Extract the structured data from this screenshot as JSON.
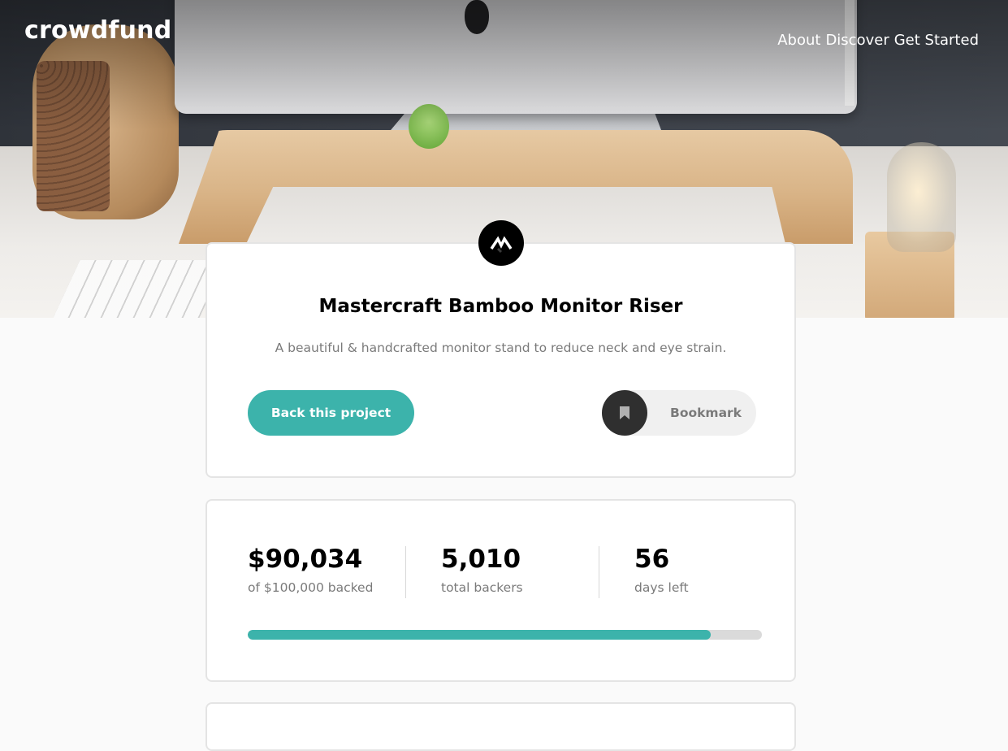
{
  "header": {
    "logo": "crowdfund",
    "nav": [
      "About",
      "Discover",
      "Get Started"
    ]
  },
  "project": {
    "logo_icon": "mastercraft-logo-icon",
    "title": "Mastercraft Bamboo Monitor Riser",
    "description": "A beautiful & handcrafted monitor stand to reduce neck and eye strain.",
    "back_label": "Back this project",
    "bookmark_label": "Bookmark",
    "bookmark_icon": "bookmark-icon"
  },
  "stats": [
    {
      "value": "$90,034",
      "label": "of $100,000 backed"
    },
    {
      "value": "5,010",
      "label": "total backers"
    },
    {
      "value": "56",
      "label": "days left"
    }
  ],
  "progress": {
    "fraction": 0.90034
  },
  "colors": {
    "accent": "#3cb3ab",
    "dark": "#2f2f2f",
    "muted_text": "#7a7a7a"
  }
}
